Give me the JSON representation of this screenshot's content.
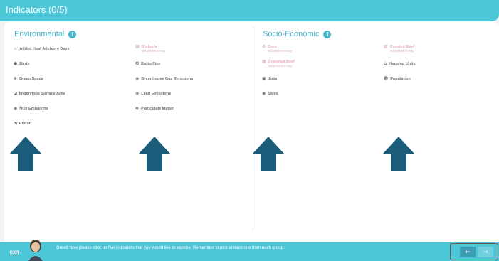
{
  "header": {
    "title": "Indicators (0/5)"
  },
  "groups": {
    "environmental": {
      "title": "Environmental"
    },
    "socio": {
      "title": "Socio-Economic"
    }
  },
  "indicators": {
    "heat": {
      "label": "Added Heat Advisory Days",
      "icon": "thermometer-icon"
    },
    "biofuels": {
      "label": "Biofuels",
      "note": "Not present in map",
      "icon": "biofuel-icon"
    },
    "birds": {
      "label": "Birds",
      "icon": "bird-icon"
    },
    "butterflies": {
      "label": "Butterflies",
      "icon": "butterfly-icon"
    },
    "green_space": {
      "label": "Green Space",
      "icon": "tree-icon"
    },
    "ghg": {
      "label": "Greenhouse Gas Emissions",
      "icon": "cloud-icon"
    },
    "impervious": {
      "label": "Impervious Surface Area",
      "icon": "surface-icon"
    },
    "lead": {
      "label": "Lead Emissions",
      "icon": "cloud-icon"
    },
    "nox": {
      "label": "NOx Emissions",
      "icon": "cloud-icon"
    },
    "pm": {
      "label": "Particulate Matter",
      "icon": "particles-icon"
    },
    "runoff": {
      "label": "Runoff",
      "icon": "runoff-icon"
    },
    "corn": {
      "label": "Corn",
      "note": "Not present in map",
      "icon": "corn-icon"
    },
    "corn_beef": {
      "label": "Cornfed Beef",
      "note": "Not present in map",
      "icon": "cow-icon"
    },
    "grass_beef": {
      "label": "Grassfed Beef",
      "note": "Not present in map",
      "icon": "cow-icon"
    },
    "housing": {
      "label": "Housing Units",
      "icon": "house-icon"
    },
    "jobs": {
      "label": "Jobs",
      "icon": "briefcase-icon"
    },
    "population": {
      "label": "Population",
      "icon": "people-icon"
    },
    "sales": {
      "label": "Sales",
      "icon": "dollar-icon"
    }
  },
  "footer": {
    "exit_label": "EXIT",
    "message": "Great! Now please click on five indicators that you would like to explore. Remember to pick at least one from each group.",
    "prev_icon": "arrow-left-icon",
    "next_icon": "arrow-right-icon"
  },
  "colors": {
    "accent": "#4dc6d8",
    "arrow": "#1a5c7a",
    "disabled": "#e8a9b8"
  }
}
